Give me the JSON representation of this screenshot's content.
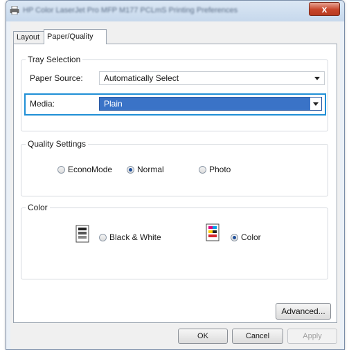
{
  "window": {
    "title": "HP Color LaserJet Pro MFP M177 PCLmS Printing Preferences",
    "close_label": "x"
  },
  "tabs": [
    {
      "label": "Layout",
      "selected": false
    },
    {
      "label": "Paper/Quality",
      "selected": true
    }
  ],
  "tray_selection": {
    "group_title": "Tray Selection",
    "paper_source_label": "Paper Source:",
    "paper_source_value": "Automatically Select",
    "media_label": "Media:",
    "media_value": "Plain"
  },
  "quality_settings": {
    "group_title": "Quality Settings",
    "options": [
      {
        "label": "EconoMode",
        "checked": false
      },
      {
        "label": "Normal",
        "checked": true
      },
      {
        "label": "Photo",
        "checked": false
      }
    ]
  },
  "color": {
    "group_title": "Color",
    "options": [
      {
        "label": "Black & White",
        "checked": false,
        "icon": "grayscale-document-icon"
      },
      {
        "label": "Color",
        "checked": true,
        "icon": "color-document-icon"
      }
    ]
  },
  "buttons": {
    "advanced": "Advanced...",
    "ok": "OK",
    "cancel": "Cancel",
    "apply": "Apply"
  },
  "colors": {
    "highlight_border": "#1f8fd6",
    "selected_dropdown": "#3a73c7",
    "close_button": "#c7452a"
  }
}
